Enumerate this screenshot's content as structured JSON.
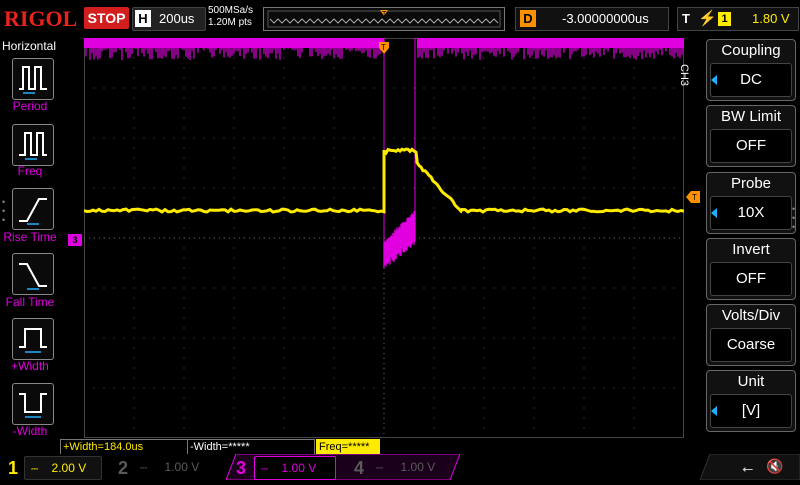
{
  "brand": "RIGOL",
  "run_state": "STOP",
  "horizontal": {
    "label": "H",
    "timebase": "200us"
  },
  "acquisition": {
    "sample_rate": "500MSa/s",
    "memory_depth": "1.20M pts"
  },
  "delay": {
    "label": "D",
    "value": "-3.00000000us"
  },
  "trigger": {
    "label": "T",
    "edge_icon": "rising-edge-icon",
    "source": "1",
    "level": "1.80 V"
  },
  "left_menu": {
    "title": "Horizontal",
    "items": [
      {
        "label": "Period",
        "icon": "period-icon"
      },
      {
        "label": "Freq",
        "icon": "freq-icon"
      },
      {
        "label": "Rise Time",
        "icon": "rise-time-icon"
      },
      {
        "label": "Fall Time",
        "icon": "fall-time-icon"
      },
      {
        "label": "+Width",
        "icon": "positive-width-icon"
      },
      {
        "label": "-Width",
        "icon": "negative-width-icon"
      }
    ]
  },
  "right_menu": {
    "channel": "CH3",
    "items": [
      {
        "title": "Coupling",
        "value": "DC",
        "has_arrow": true
      },
      {
        "title": "BW Limit",
        "value": "OFF",
        "has_arrow": false
      },
      {
        "title": "Probe",
        "value": "10X",
        "has_arrow": true
      },
      {
        "title": "Invert",
        "value": "OFF",
        "has_arrow": false
      },
      {
        "title": "Volts/Div",
        "value": "Coarse",
        "has_arrow": false
      },
      {
        "title": "Unit",
        "value": "[V]",
        "has_arrow": true
      }
    ]
  },
  "measurements": [
    {
      "text": "+Width=184.0us",
      "color": "#ffeb00",
      "bg": "#000000"
    },
    {
      "text": "-Width=*****",
      "color": "#ffffff",
      "bg": "#000000"
    },
    {
      "text": "Freq=*****",
      "color": "#000000",
      "bg": "#ffeb00"
    }
  ],
  "channels": [
    {
      "num": "1",
      "scale": "2.00 V",
      "color": "#ffeb00",
      "active": true
    },
    {
      "num": "2",
      "scale": "1.00 V",
      "color": "#5a5a5a",
      "active": false
    },
    {
      "num": "3",
      "scale": "1.00 V",
      "color": "#e000e0",
      "active": true
    },
    {
      "num": "4",
      "scale": "1.00 V",
      "color": "#5a5a5a",
      "active": false
    }
  ],
  "markers": {
    "trigger_pos": "T",
    "ch3_marker": "3"
  },
  "colors": {
    "ch1": "#ffeb00",
    "ch3": "#e000e0",
    "trigger": "#ff9000",
    "accent": "#1fb0ff"
  }
}
